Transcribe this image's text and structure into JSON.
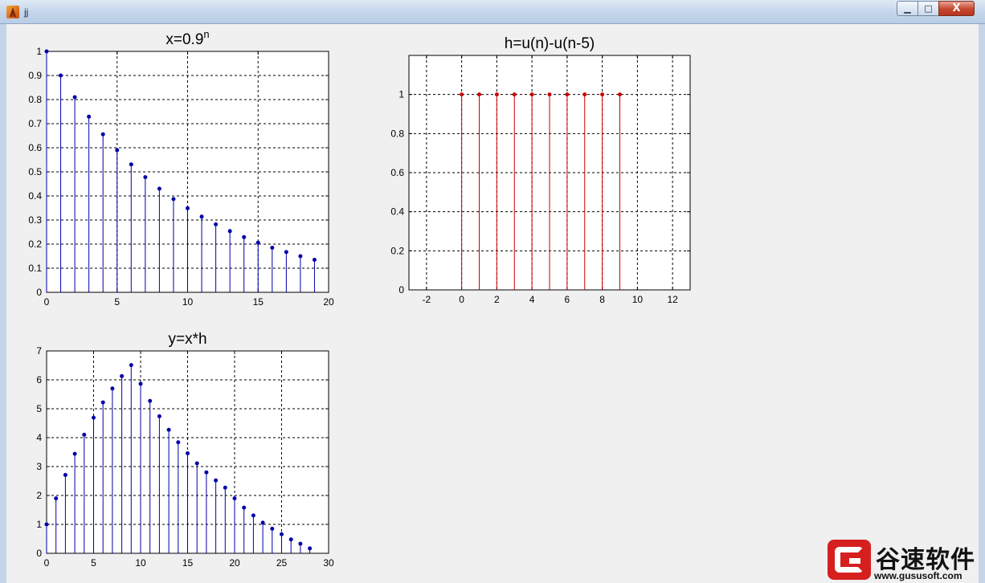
{
  "window": {
    "title": "jj",
    "controls": {
      "minimize": "▁",
      "maximize": "□",
      "close": "X"
    }
  },
  "watermark": {
    "brand": "谷速软件",
    "url": "www.gususoft.com"
  },
  "colors": {
    "series_x": "#0000aa",
    "series_h": "#cc0000",
    "series_y": "#0000aa"
  },
  "chart_data": [
    {
      "type": "stem",
      "title": "x=0.9",
      "title_superscript": "n",
      "xlim": [
        0,
        20
      ],
      "ylim": [
        0,
        1
      ],
      "xticks": [
        0,
        5,
        10,
        15,
        20
      ],
      "yticks": [
        0,
        0.1,
        0.2,
        0.3,
        0.4,
        0.5,
        0.6,
        0.7,
        0.8,
        0.9,
        1
      ],
      "grid": true,
      "color": "#0000aa",
      "x": [
        0,
        1,
        2,
        3,
        4,
        5,
        6,
        7,
        8,
        9,
        10,
        11,
        12,
        13,
        14,
        15,
        16,
        17,
        18,
        19
      ],
      "y": [
        1,
        0.9,
        0.81,
        0.729,
        0.656,
        0.59,
        0.531,
        0.478,
        0.43,
        0.387,
        0.349,
        0.314,
        0.282,
        0.254,
        0.229,
        0.206,
        0.185,
        0.167,
        0.15,
        0.135
      ]
    },
    {
      "type": "stem",
      "title": "h=u(n)-u(n-5)",
      "xlim": [
        -3,
        13
      ],
      "ylim": [
        0,
        1.2
      ],
      "xticks": [
        -2,
        0,
        2,
        4,
        6,
        8,
        10,
        12
      ],
      "yticks": [
        0,
        0.2,
        0.4,
        0.6,
        0.8,
        1
      ],
      "grid": true,
      "color": "#cc0000",
      "x": [
        0,
        1,
        2,
        3,
        4,
        5,
        6,
        7,
        8,
        9
      ],
      "y": [
        1,
        1,
        1,
        1,
        1,
        1,
        1,
        1,
        1,
        1
      ]
    },
    {
      "type": "stem",
      "title": "y=x*h",
      "xlim": [
        0,
        30
      ],
      "ylim": [
        0,
        7
      ],
      "xticks": [
        0,
        5,
        10,
        15,
        20,
        25,
        30
      ],
      "yticks": [
        0,
        1,
        2,
        3,
        4,
        5,
        6,
        7
      ],
      "grid": true,
      "color": "#0000aa",
      "x": [
        0,
        1,
        2,
        3,
        4,
        5,
        6,
        7,
        8,
        9,
        10,
        11,
        12,
        13,
        14,
        15,
        16,
        17,
        18,
        19,
        20,
        21,
        22,
        23,
        24,
        25,
        26,
        27,
        28
      ],
      "y": [
        1,
        1.9,
        2.71,
        3.44,
        4.1,
        4.69,
        5.22,
        5.7,
        6.13,
        6.51,
        5.86,
        5.27,
        4.74,
        4.27,
        3.84,
        3.46,
        3.11,
        2.8,
        2.52,
        2.27,
        1.9,
        1.58,
        1.31,
        1.06,
        0.85,
        0.66,
        0.48,
        0.33,
        0.17
      ]
    }
  ]
}
